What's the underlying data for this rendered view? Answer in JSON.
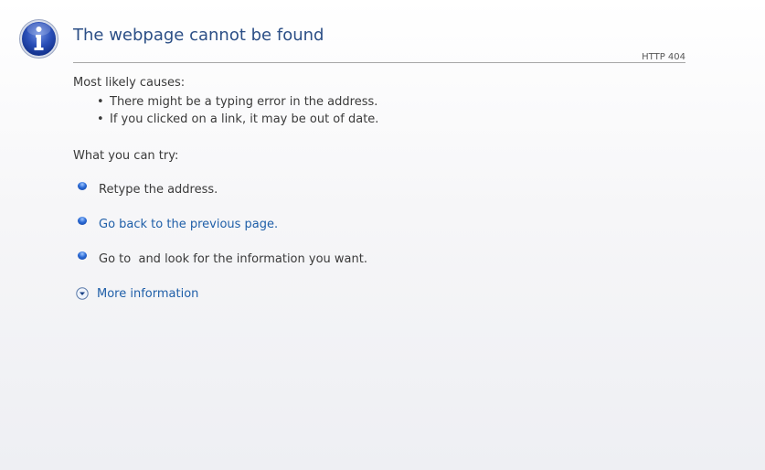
{
  "page": {
    "title": "The webpage cannot be found",
    "http_code": "HTTP 404"
  },
  "causes": {
    "heading": "Most likely causes:",
    "items": [
      "There might be a typing error in the address.",
      "If you clicked on a link, it may be out of date."
    ]
  },
  "try": {
    "heading": "What you can try:",
    "items": [
      {
        "label": "Retype the address.",
        "is_link": false
      },
      {
        "label": "Go back to the previous page.",
        "is_link": true
      },
      {
        "label": "Go to  and look for the information you want.",
        "is_link": false
      }
    ],
    "more_info": "More information"
  },
  "icons": {
    "info": "info-icon",
    "bullet": "blue-bullet-icon",
    "more": "chevron-down-circle-icon"
  },
  "colors": {
    "title": "#2c4f86",
    "link": "#1f5fa8",
    "text": "#3a3a3a",
    "icon_blue": "#1f4fb0"
  }
}
